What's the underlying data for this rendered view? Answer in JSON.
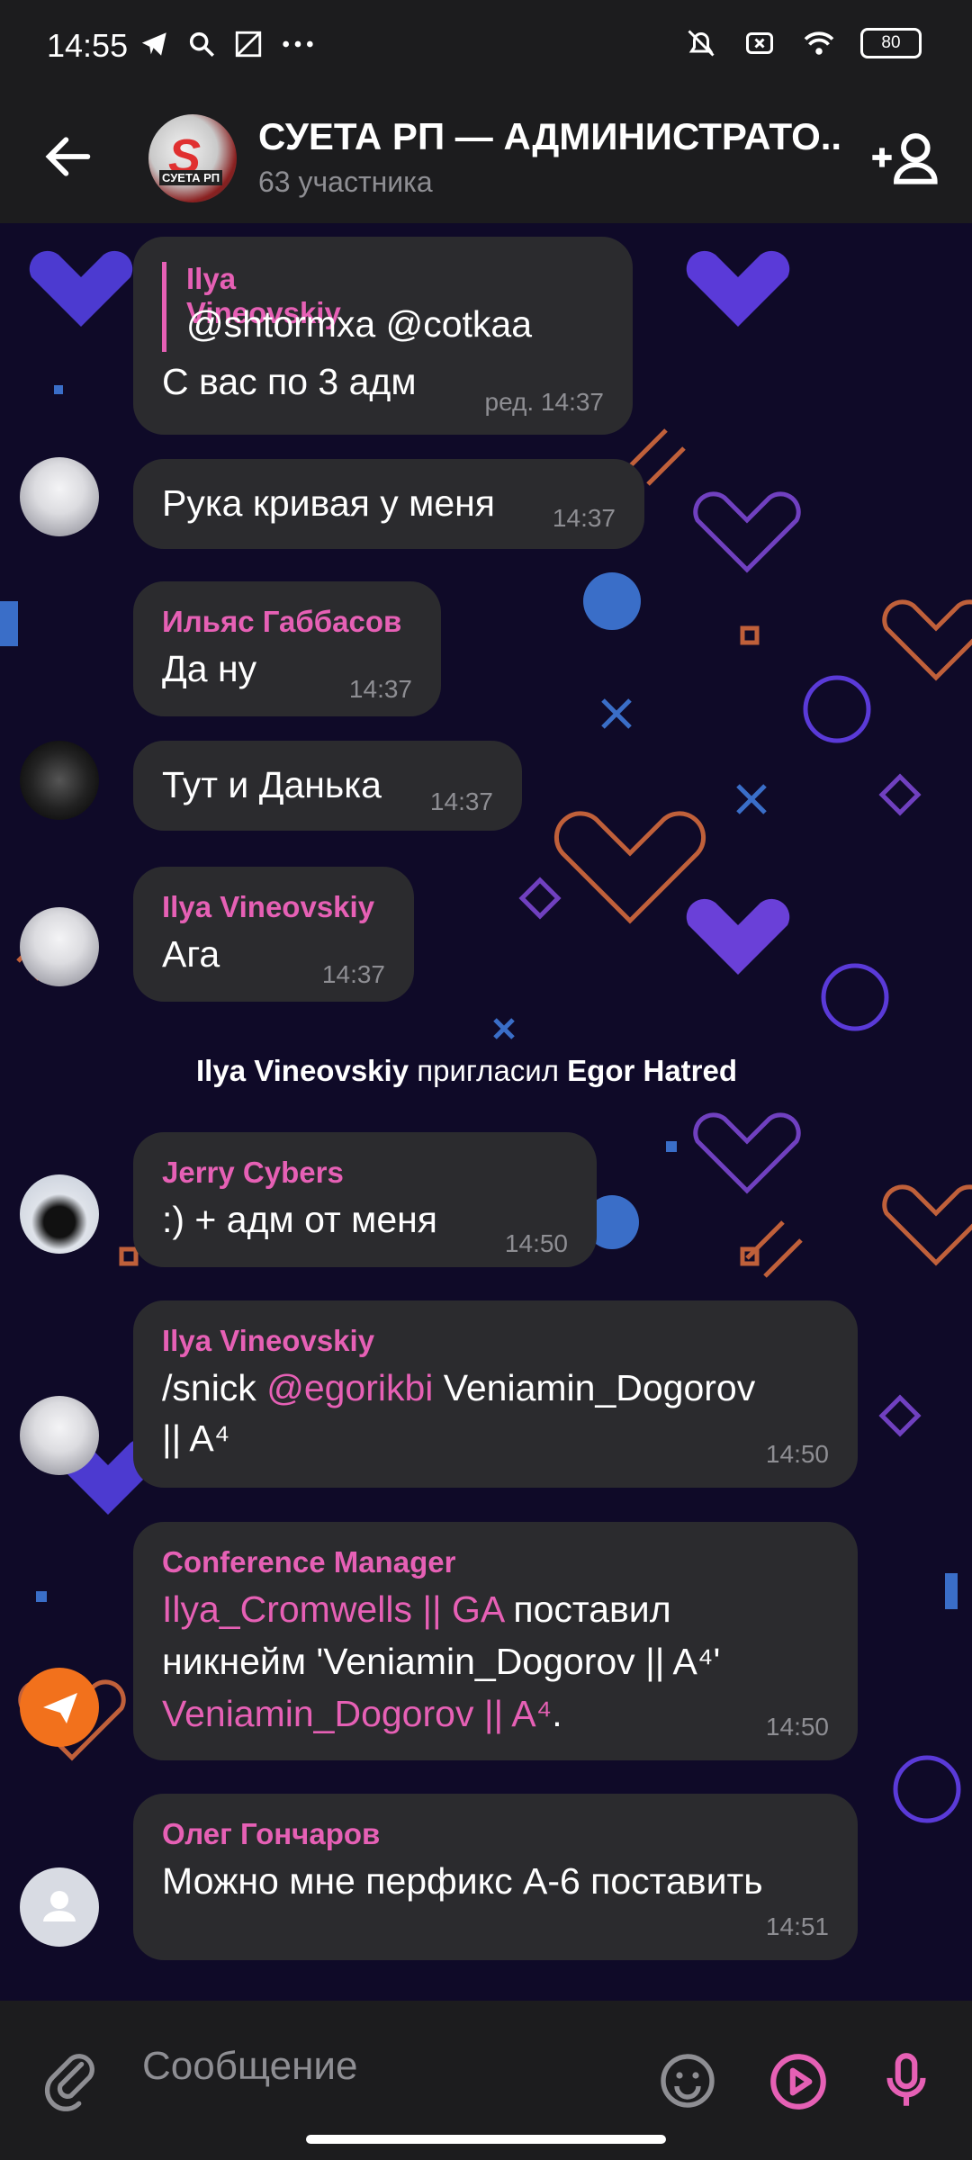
{
  "status_bar": {
    "time": "14:55",
    "battery": "80"
  },
  "header": {
    "title": "СУЕТА РП — АДМИНИСТРАТО...",
    "subtitle": "63 участника",
    "avatar_label": "СУЕТА РП"
  },
  "messages": [
    {
      "sender": "Ilya Vineovskiy",
      "quote": "@shtormxa  @cotkaa",
      "text": "С вас по 3 адм",
      "time": "ред. 14:37"
    },
    {
      "text": "Рука кривая у меня",
      "time": "14:37"
    },
    {
      "sender": "Ильяс Габбасов",
      "text": "Да ну",
      "time": "14:37"
    },
    {
      "text": "Тут и Данька",
      "time": "14:37"
    },
    {
      "sender": "Ilya Vineovskiy",
      "text": "Ага",
      "time": "14:37"
    },
    {
      "sender": "Jerry Cybers",
      "text": ":) + адм от меня",
      "time": "14:50"
    },
    {
      "sender": "Ilya Vineovskiy",
      "text_a": "/snick ",
      "mention": "@egorikbi",
      "text_b": " Veniamin_Dogorov",
      "text_c": "|| A⁴",
      "time": "14:50"
    },
    {
      "sender": "Conference Manager",
      "link1": "Ilya_Cromwells || GA",
      "text_a": " поставил",
      "text_b": "никнейм 'Veniamin_Dogorov || A⁴'",
      "link2": "Veniamin_Dogorov || A⁴",
      "text_c": ".",
      "time": "14:50"
    },
    {
      "sender": "Олег Гончаров",
      "text": "Можно мне перфикс А-6 поставить",
      "time": "14:51"
    }
  ],
  "service": {
    "actor": "Ilya Vineovskiy",
    "action": " пригласил ",
    "target": "Egor Hatred"
  },
  "composer": {
    "placeholder": "Сообщение"
  }
}
